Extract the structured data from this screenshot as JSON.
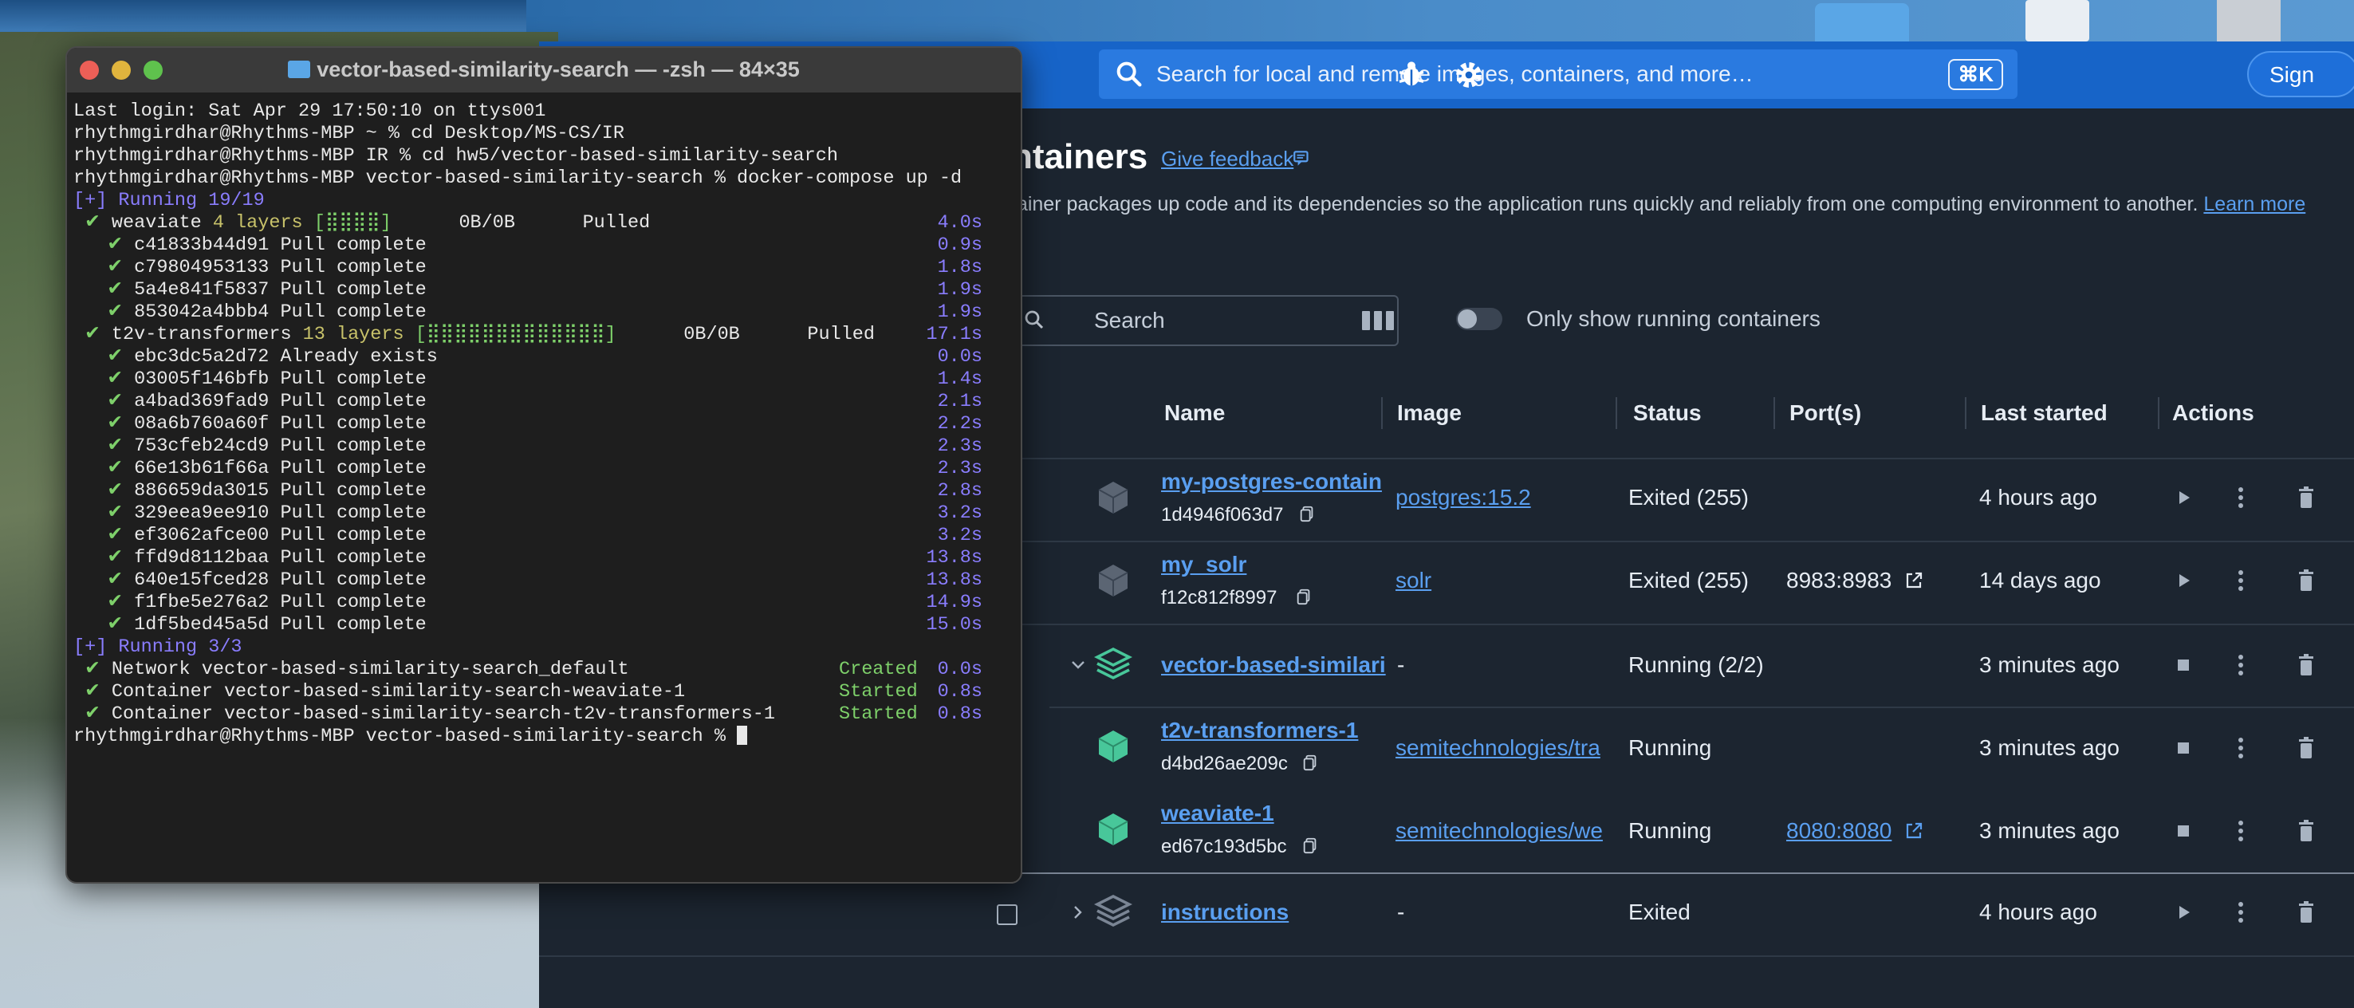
{
  "colors": {
    "docker_blue": "#1764c8",
    "link_blue": "#5a9ff0",
    "running_green": "#48c79a",
    "terminal_bg": "#1e1e1e"
  },
  "docker": {
    "search_placeholder": "Search for local and remote images, containers, and more…",
    "search_shortcut": "⌘K",
    "sign_in_label": "Sign",
    "page_title": "ntainers",
    "feedback_label": "Give feedback",
    "description": "tainer packages up code and its dependencies so the application runs quickly and reliably from one computing environment to another.",
    "learn_more": "Learn more",
    "filter_placeholder": "Search",
    "only_running_label": "Only show running containers",
    "columns": {
      "name": "Name",
      "image": "Image",
      "status": "Status",
      "ports": "Port(s)",
      "last_started": "Last started",
      "actions": "Actions"
    },
    "rows": [
      {
        "name": "my-postgres-contain",
        "id": "1d4946f063d7",
        "image": "postgres:15.2",
        "status": "Exited (255)",
        "port": "",
        "last_started": "4 hours ago",
        "icon": "container-icon"
      },
      {
        "name": "my_solr",
        "id": "f12c812f8997",
        "image": "solr",
        "status": "Exited (255)",
        "port": "8983:8983",
        "last_started": "14 days ago",
        "icon": "container-icon"
      },
      {
        "name": "vector-based-similari",
        "id": "",
        "image": "-",
        "status": "Running (2/2)",
        "port": "",
        "last_started": "3 minutes ago",
        "icon": "stack-icon"
      },
      {
        "name": "t2v-transformers-1",
        "id": "d4bd26ae209c",
        "image": "semitechnologies/tra",
        "status": "Running",
        "port": "",
        "last_started": "3 minutes ago",
        "icon": "container-icon"
      },
      {
        "name": "weaviate-1",
        "id": "ed67c193d5bc",
        "image": "semitechnologies/we",
        "status": "Running",
        "port": "8080:8080",
        "last_started": "3 minutes ago",
        "icon": "container-icon"
      },
      {
        "name": "instructions",
        "id": "",
        "image": "-",
        "status": "Exited",
        "port": "",
        "last_started": "4 hours ago",
        "icon": "stack-icon"
      }
    ]
  },
  "terminal": {
    "title": "vector-based-similarity-search — -zsh — 84×35",
    "lines": [
      {
        "text": "Last login: Sat Apr 29 17:50:10 on ttys001",
        "status": "",
        "time": ""
      },
      {
        "text": "rhythmgirdhar@Rhythms-MBP ~ % cd Desktop/MS-CS/IR",
        "status": "",
        "time": ""
      },
      {
        "text": "rhythmgirdhar@Rhythms-MBP IR % cd hw5/vector-based-similarity-search",
        "status": "",
        "time": ""
      },
      {
        "text": "rhythmgirdhar@Rhythms-MBP vector-based-similarity-search % docker-compose up -d",
        "status": "",
        "time": ""
      },
      {
        "text": "[+] Running 19/19",
        "status": "",
        "time": ""
      },
      {
        "text": " ✔ weaviate 4 layers [⣿⣿⣿⣿]      0B/0B      Pulled",
        "status": "",
        "time": "4.0s"
      },
      {
        "text": "   ✔ c41833b44d91 Pull complete",
        "status": "",
        "time": "0.9s"
      },
      {
        "text": "   ✔ c79804953133 Pull complete",
        "status": "",
        "time": "1.8s"
      },
      {
        "text": "   ✔ 5a4e841f5837 Pull complete",
        "status": "",
        "time": "1.9s"
      },
      {
        "text": "   ✔ 853042a4bbb4 Pull complete",
        "status": "",
        "time": "1.9s"
      },
      {
        "text": " ✔ t2v-transformers 13 layers [⣿⣿⣿⣿⣿⣿⣿⣿⣿⣿⣿⣿⣿]      0B/0B      Pulled",
        "status": "",
        "time": "17.1s"
      },
      {
        "text": "   ✔ ebc3dc5a2d72 Already exists",
        "status": "",
        "time": "0.0s"
      },
      {
        "text": "   ✔ 03005f146bfb Pull complete",
        "status": "",
        "time": "1.4s"
      },
      {
        "text": "   ✔ a4bad369fad9 Pull complete",
        "status": "",
        "time": "2.1s"
      },
      {
        "text": "   ✔ 08a6b760a60f Pull complete",
        "status": "",
        "time": "2.2s"
      },
      {
        "text": "   ✔ 753cfeb24cd9 Pull complete",
        "status": "",
        "time": "2.3s"
      },
      {
        "text": "   ✔ 66e13b61f66a Pull complete",
        "status": "",
        "time": "2.3s"
      },
      {
        "text": "   ✔ 886659da3015 Pull complete",
        "status": "",
        "time": "2.8s"
      },
      {
        "text": "   ✔ 329eea9ee910 Pull complete",
        "status": "",
        "time": "3.2s"
      },
      {
        "text": "   ✔ ef3062afce00 Pull complete",
        "status": "",
        "time": "3.2s"
      },
      {
        "text": "   ✔ ffd9d8112baa Pull complete",
        "status": "",
        "time": "13.8s"
      },
      {
        "text": "   ✔ 640e15fced28 Pull complete",
        "status": "",
        "time": "13.8s"
      },
      {
        "text": "   ✔ f1fbe5e276a2 Pull complete",
        "status": "",
        "time": "14.9s"
      },
      {
        "text": "   ✔ 1df5bed45a5d Pull complete",
        "status": "",
        "time": "15.0s"
      },
      {
        "text": "[+] Running 3/3",
        "status": "",
        "time": ""
      },
      {
        "text": " ✔ Network vector-based-similarity-search_default",
        "status": "Created",
        "time": "0.0s"
      },
      {
        "text": " ✔ Container vector-based-similarity-search-weaviate-1",
        "status": "Started",
        "time": "0.8s"
      },
      {
        "text": " ✔ Container vector-based-similarity-search-t2v-transformers-1",
        "status": "Started",
        "time": "0.8s"
      }
    ],
    "prompt": "rhythmgirdhar@Rhythms-MBP vector-based-similarity-search % "
  }
}
